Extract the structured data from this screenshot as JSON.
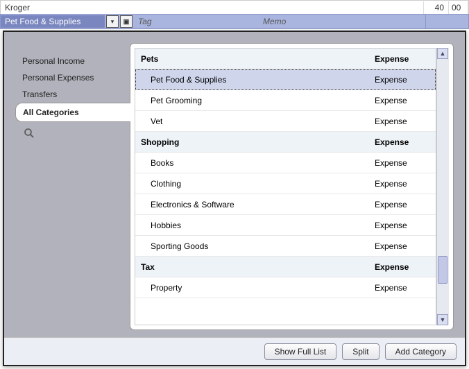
{
  "register": {
    "payee": "Kroger",
    "amount_major": "40",
    "amount_minor": "00",
    "category_value": "Pet Food & Supplies",
    "tag_placeholder": "Tag",
    "memo_placeholder": "Memo"
  },
  "sidebar": {
    "items": [
      {
        "label": "Personal Income",
        "active": false
      },
      {
        "label": "Personal Expenses",
        "active": false
      },
      {
        "label": "Transfers",
        "active": false
      },
      {
        "label": "All Categories",
        "active": true
      }
    ]
  },
  "categories": [
    {
      "name": "Pets",
      "type": "Expense",
      "group": true,
      "selected": false
    },
    {
      "name": "Pet Food & Supplies",
      "type": "Expense",
      "group": false,
      "selected": true
    },
    {
      "name": "Pet Grooming",
      "type": "Expense",
      "group": false,
      "selected": false
    },
    {
      "name": "Vet",
      "type": "Expense",
      "group": false,
      "selected": false
    },
    {
      "name": "Shopping",
      "type": "Expense",
      "group": true,
      "selected": false
    },
    {
      "name": "Books",
      "type": "Expense",
      "group": false,
      "selected": false
    },
    {
      "name": "Clothing",
      "type": "Expense",
      "group": false,
      "selected": false
    },
    {
      "name": "Electronics & Software",
      "type": "Expense",
      "group": false,
      "selected": false
    },
    {
      "name": "Hobbies",
      "type": "Expense",
      "group": false,
      "selected": false
    },
    {
      "name": "Sporting Goods",
      "type": "Expense",
      "group": false,
      "selected": false
    },
    {
      "name": "Tax",
      "type": "Expense",
      "group": true,
      "selected": false
    },
    {
      "name": "Property",
      "type": "Expense",
      "group": false,
      "selected": false
    }
  ],
  "footer": {
    "show_full_list": "Show Full List",
    "split": "Split",
    "add_category": "Add Category"
  }
}
